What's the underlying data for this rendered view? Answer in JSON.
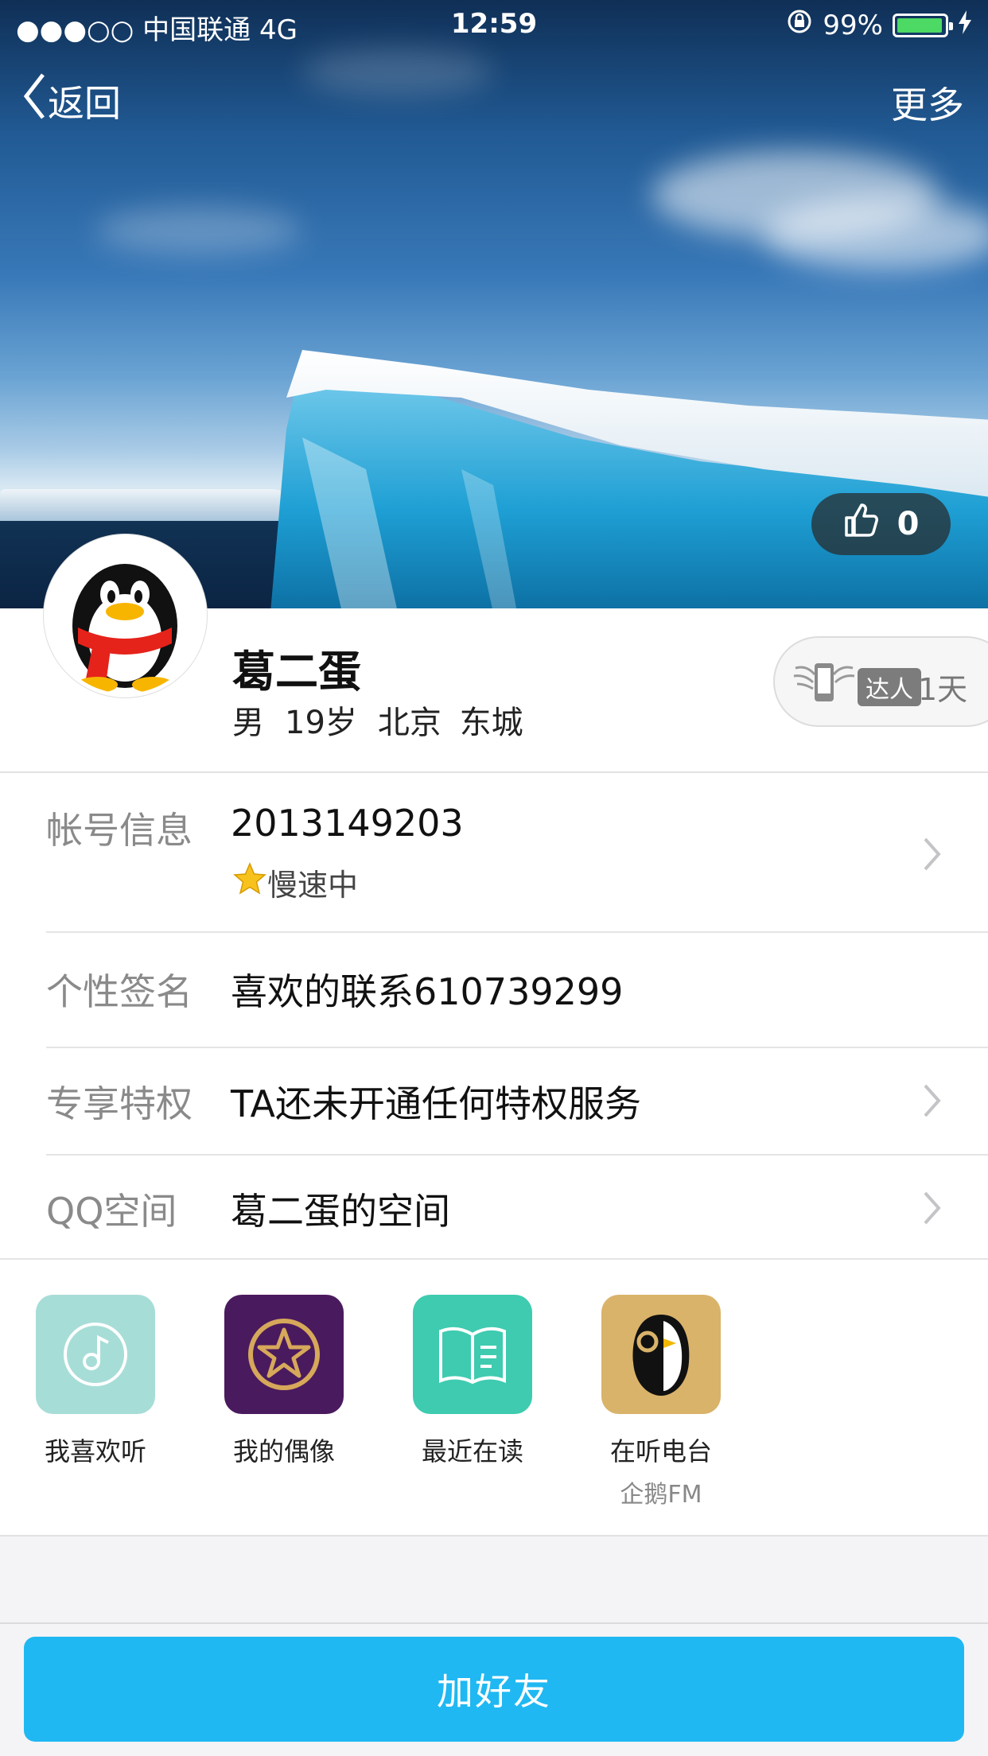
{
  "status_bar": {
    "carrier": "●●●○○ 中国联通   4G",
    "time": "12:59",
    "battery_pct": "99%",
    "battery_level": 0.99
  },
  "nav": {
    "back_label": "返回",
    "more_label": "更多"
  },
  "likes": {
    "count": "0"
  },
  "profile": {
    "name": "葛二蛋",
    "gender": "男",
    "age": "19岁",
    "location": "北京  东城",
    "daren_tag": "达人",
    "daren_days": "1天"
  },
  "info_rows": {
    "account": {
      "label": "帐号信息",
      "value": "2013149203",
      "sub": "慢速中"
    },
    "signature": {
      "label": "个性签名",
      "value": "喜欢的联系610739299"
    },
    "privilege": {
      "label": "专享特权",
      "value": "TA还未开通任何特权服务"
    },
    "qzone": {
      "label": "QQ空间",
      "value": "葛二蛋的空间"
    }
  },
  "apps": [
    {
      "label": "我喜欢听",
      "sub": "",
      "icon": "music-note-icon",
      "color": "#a7ddd7"
    },
    {
      "label": "我的偶像",
      "sub": "",
      "icon": "star-idol-icon",
      "color": "#4a1a5e"
    },
    {
      "label": "最近在读",
      "sub": "",
      "icon": "open-book-icon",
      "color": "#3ecbb0"
    },
    {
      "label": "在听电台",
      "sub": "企鹅FM",
      "icon": "penguin-fm-icon",
      "color": "#d9b36a"
    }
  ],
  "actions": {
    "add_friend": "加好友"
  },
  "colors": {
    "primary_button": "#20b8f2",
    "label_gray": "#8a8a8a",
    "battery_green": "#4cd964"
  }
}
